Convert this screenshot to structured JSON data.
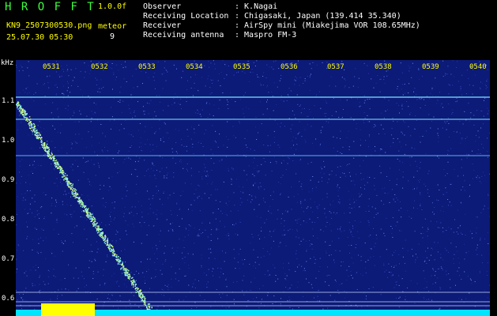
{
  "app": {
    "name": "H R O F F T",
    "version": "1.0.0f"
  },
  "file": {
    "name": "KN9_2507300530.png",
    "datetime": "25.07.30 05:30"
  },
  "meteor": {
    "label": "meteor",
    "count": "9"
  },
  "info": [
    {
      "key": "Observer",
      "value": ": K.Nagai"
    },
    {
      "key": "Receiving Location",
      "value": ": Chigasaki, Japan (139.414 35.340)"
    },
    {
      "key": "Receiver",
      "value": ": AirSpy mini (Miakejima VOR 108.65MHz)"
    },
    {
      "key": "Receiving antenna",
      "value": ": Maspro FM-3"
    }
  ],
  "axis": {
    "unit": "kHz",
    "time_ticks": [
      "0531",
      "0532",
      "0533",
      "0534",
      "0535",
      "0536",
      "0537",
      "0538",
      "0539",
      "0540"
    ],
    "freq_ticks": [
      "1.1",
      "1.0",
      "0.9",
      "0.8",
      "0.7",
      "0.6"
    ]
  },
  "colors": {
    "background": "#0c1a78",
    "trace": "#b8ff7a",
    "carrier": "#7ee8ff",
    "noise_floor": "#00e5ff",
    "burst": "#ffff00"
  }
}
